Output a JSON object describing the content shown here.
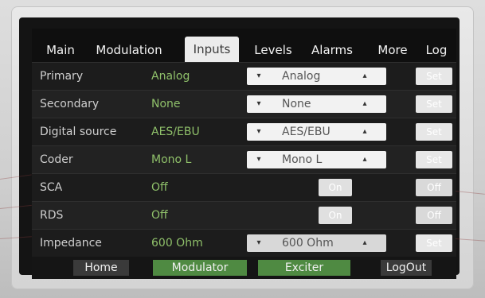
{
  "tabs": [
    {
      "label": "Main"
    },
    {
      "label": "Modulation"
    },
    {
      "label": "Inputs",
      "active": true
    },
    {
      "label": "Levels"
    },
    {
      "label": "Alarms"
    },
    {
      "label": "More"
    },
    {
      "label": "Log"
    }
  ],
  "rows": [
    {
      "label": "Primary",
      "value": "Analog",
      "select": "Analog",
      "action": "Set"
    },
    {
      "label": "Secondary",
      "value": "None",
      "select": "None",
      "action": "Set"
    },
    {
      "label": "Digital source",
      "value": "AES/EBU",
      "select": "AES/EBU",
      "action": "Set"
    },
    {
      "label": "Coder",
      "value": "Mono L",
      "select": "Mono L",
      "action": "Set"
    },
    {
      "label": "SCA",
      "value": "Off",
      "on_label": "On",
      "off_label": "Off"
    },
    {
      "label": "RDS",
      "value": "Off",
      "on_label": "On",
      "off_label": "Off"
    },
    {
      "label": "Impedance",
      "value": "600 Ohm",
      "select": "600 Ohm",
      "action": "Set"
    }
  ],
  "icons": {
    "prev_arrow": "▾",
    "next_arrow": "▴"
  },
  "bottom_bar": {
    "home": "Home",
    "modulator": "Modulator",
    "exciter": "Exciter",
    "logout": "LogOut"
  },
  "colors": {
    "active_value": "#8fc06a",
    "green_button": "#4f8a42",
    "screen_bg": "#1a1a1a"
  }
}
